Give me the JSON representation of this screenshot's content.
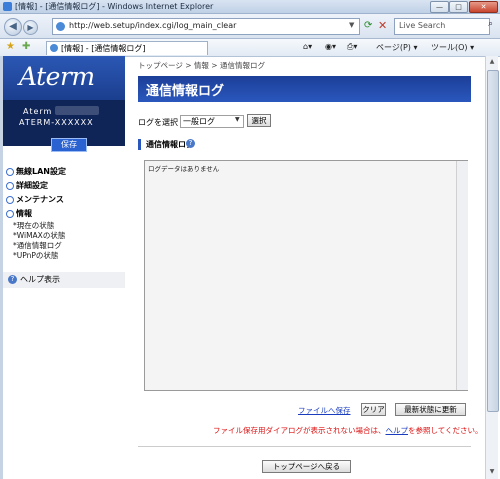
{
  "window": {
    "title": "[情報] - [通信情報ログ] - Windows Internet Explorer",
    "minimize": "—",
    "maximize": "□",
    "close": "✕"
  },
  "address": {
    "url": "http://web.setup/index.cgi/log_main_clear",
    "search_placeholder": "Live Search"
  },
  "tab": {
    "label": "[情報] - [通信情報ログ]"
  },
  "toolbar": {
    "page": "ページ(P)",
    "tools": "ツール(O)"
  },
  "sidebar": {
    "logo": "Aterm",
    "model_line1": "Aterm",
    "model_line2": "ATERM-XXXXXX",
    "save": "保存",
    "menu": [
      {
        "label": "無線LAN設定"
      },
      {
        "label": "詳細設定"
      },
      {
        "label": "メンテナンス"
      },
      {
        "label": "情報"
      }
    ],
    "submenu": [
      {
        "label": "*現在の状態"
      },
      {
        "label": "*WiMAXの状態"
      },
      {
        "label": "*通信情報ログ"
      },
      {
        "label": "*UPnPの状態"
      }
    ],
    "help": "ヘルプ表示"
  },
  "main": {
    "breadcrumb": "トップページ > 情報 > 通信情報ログ",
    "title": "通信情報ログ",
    "select_label": "ログを選択",
    "select_value": "一般ログ",
    "select_button": "選択",
    "section_title": "通信情報ログ",
    "log_text": "ログデータはありません",
    "save_link": "ファイルへ保存",
    "clear_button": "クリア",
    "refresh_button": "最新状態に更新",
    "notice_before": "ファイル保存用ダイアログが表示されない場合は、",
    "notice_link": "ヘルプ",
    "notice_after": "を参照してください。",
    "top_button": "トップページへ戻る"
  },
  "colors": {
    "header_blue": "#1c3f98",
    "notice_red": "#dd1111",
    "link_blue": "#1a3dbf"
  }
}
